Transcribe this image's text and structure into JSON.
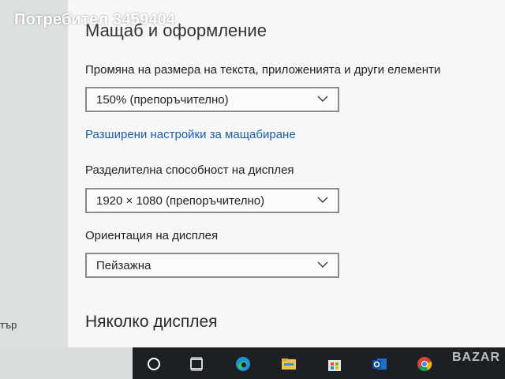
{
  "watermark": "Потребител 3459404",
  "scale_section": {
    "title": "Мащаб и оформление",
    "size_label": "Промяна на размера на текста, приложенията и други елементи",
    "size_value": "150% (препоръчително)",
    "advanced_link": "Разширени настройки за мащабиране",
    "resolution_label": "Разделителна способност на дисплея",
    "resolution_value": "1920 × 1080 (препоръчително)",
    "orientation_label": "Ориентация на дисплея",
    "orientation_value": "Пейзажна"
  },
  "multiple_displays": {
    "title": "Няколко дисплея"
  },
  "sidebar": {
    "partial_label": "тър"
  },
  "taskbar": {
    "icons": [
      "cortana-icon",
      "task-view-icon",
      "edge-icon",
      "file-explorer-icon",
      "store-icon",
      "outlook-icon",
      "chrome-icon"
    ]
  },
  "corner_watermark": "BAZAR"
}
